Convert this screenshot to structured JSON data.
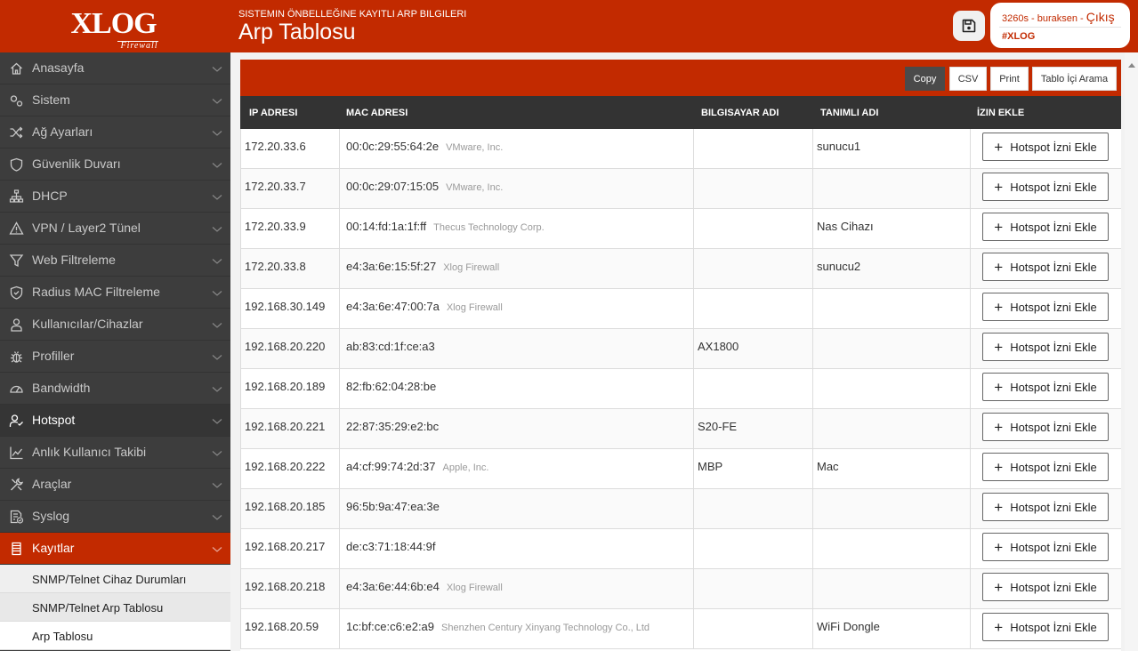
{
  "header": {
    "logo_text": "XLOG",
    "logo_sub": "Firewall",
    "subtitle": "SISTEMIN ÖNBELLEĞINE KAYITLI ARP BILGILERI",
    "title": "Arp Tablosu",
    "save_icon": "floppy-disk-icon",
    "user": "3260s - buraksen",
    "user_separator": " - ",
    "logout": "Çıkış",
    "tag": "#XLOG"
  },
  "sidebar": {
    "items": [
      {
        "label": "Anasayfa",
        "icon": "home-icon"
      },
      {
        "label": "Sistem",
        "icon": "cogs-icon"
      },
      {
        "label": "Ağ Ayarları",
        "icon": "shuffle-icon"
      },
      {
        "label": "Güvenlik Duvarı",
        "icon": "shield-icon"
      },
      {
        "label": "DHCP",
        "icon": "sitemap-icon"
      },
      {
        "label": "VPN / Layer2 Tünel",
        "icon": "warning-icon"
      },
      {
        "label": "Web Filtreleme",
        "icon": "filter-icon"
      },
      {
        "label": "Radius MAC Filtreleme",
        "icon": "shield-check-icon"
      },
      {
        "label": "Kullanıcılar/Cihazlar",
        "icon": "user-icon"
      },
      {
        "label": "Profiller",
        "icon": "bug-icon"
      },
      {
        "label": "Bandwidth",
        "icon": "gauge-icon"
      },
      {
        "label": "Hotspot",
        "icon": "user-check-icon"
      },
      {
        "label": "Anlık Kullanıcı Takibi",
        "icon": "chart-line-icon"
      },
      {
        "label": "Araçlar",
        "icon": "tools-icon"
      },
      {
        "label": "Syslog",
        "icon": "file-check-icon"
      },
      {
        "label": "Kayıtlar",
        "icon": "scroll-icon"
      }
    ],
    "sub_items": [
      {
        "label": "SNMP/Telnet Cihaz Durumları"
      },
      {
        "label": "SNMP/Telnet Arp Tablosu"
      },
      {
        "label": "Arp Tablosu"
      }
    ]
  },
  "toolbar": {
    "copy": "Copy",
    "csv": "CSV",
    "print": "Print",
    "search": "Tablo İçi Arama"
  },
  "table": {
    "columns": [
      "IP ADRESI",
      "MAC ADRESI",
      "BILGISAYAR ADI",
      "TANIMLI ADI",
      "İZIN EKLE"
    ],
    "action_label": "Hotspot İzni Ekle",
    "rows": [
      {
        "ip": "172.20.33.6",
        "mac": "00:0c:29:55:64:2e",
        "vendor": "VMware, Inc.",
        "host": "",
        "defined": "sunucu1"
      },
      {
        "ip": "172.20.33.7",
        "mac": "00:0c:29:07:15:05",
        "vendor": "VMware, Inc.",
        "host": "",
        "defined": ""
      },
      {
        "ip": "172.20.33.9",
        "mac": "00:14:fd:1a:1f:ff",
        "vendor": "Thecus Technology Corp.",
        "host": "",
        "defined": "Nas Cihazı"
      },
      {
        "ip": "172.20.33.8",
        "mac": "e4:3a:6e:15:5f:27",
        "vendor": "Xlog Firewall",
        "host": "",
        "defined": "sunucu2"
      },
      {
        "ip": "192.168.30.149",
        "mac": "e4:3a:6e:47:00:7a",
        "vendor": "Xlog Firewall",
        "host": "",
        "defined": ""
      },
      {
        "ip": "192.168.20.220",
        "mac": "ab:83:cd:1f:ce:a3",
        "vendor": "",
        "host": "AX1800",
        "defined": ""
      },
      {
        "ip": "192.168.20.189",
        "mac": "82:fb:62:04:28:be",
        "vendor": "",
        "host": "",
        "defined": ""
      },
      {
        "ip": "192.168.20.221",
        "mac": "22:87:35:29:e2:bc",
        "vendor": "",
        "host": "S20-FE",
        "defined": ""
      },
      {
        "ip": "192.168.20.222",
        "mac": "a4:cf:99:74:2d:37",
        "vendor": "Apple, Inc.",
        "host": "MBP",
        "defined": "Mac"
      },
      {
        "ip": "192.168.20.185",
        "mac": "96:5b:9a:47:ea:3e",
        "vendor": "",
        "host": "",
        "defined": ""
      },
      {
        "ip": "192.168.20.217",
        "mac": "de:c3:71:18:44:9f",
        "vendor": "",
        "host": "",
        "defined": ""
      },
      {
        "ip": "192.168.20.218",
        "mac": "e4:3a:6e:44:6b:e4",
        "vendor": "Xlog Firewall",
        "host": "",
        "defined": ""
      },
      {
        "ip": "192.168.20.59",
        "mac": "1c:bf:ce:c6:e2:a9",
        "vendor": "Shenzhen Century Xinyang Technology Co., Ltd",
        "host": "",
        "defined": "WiFi Dongle"
      }
    ]
  },
  "colors": {
    "brand": "#c22a00",
    "sidebar": "#3d3d3d",
    "table_header": "#333333"
  }
}
